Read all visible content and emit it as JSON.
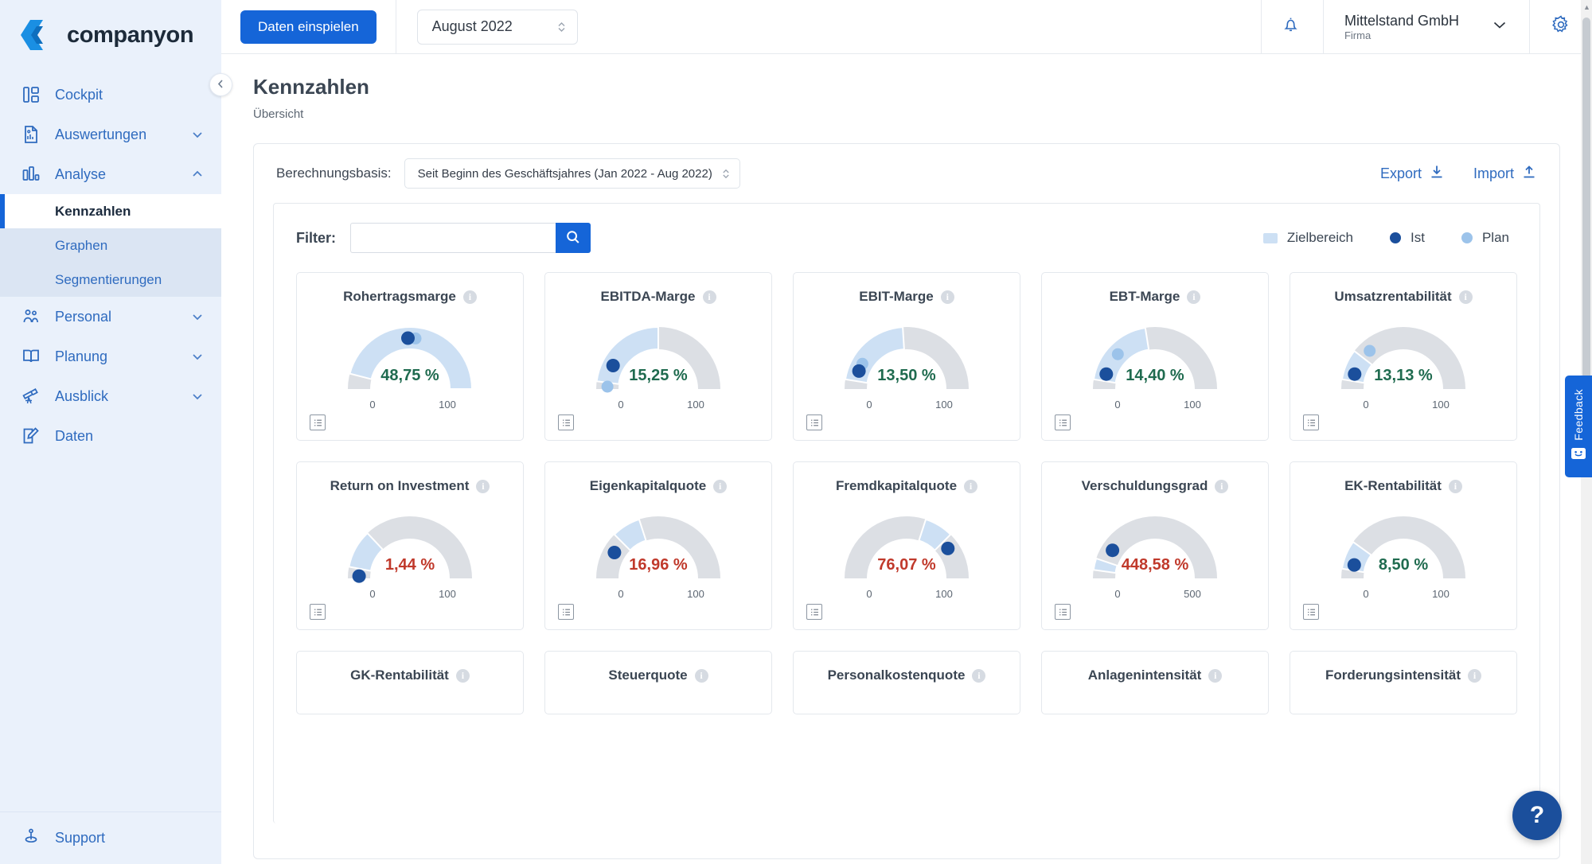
{
  "brand": {
    "name": "companyon",
    "logo_icon": "companyon-logo-icon"
  },
  "sidebar": {
    "items": [
      {
        "label": "Cockpit",
        "icon": "dashboard-icon",
        "chevron": ""
      },
      {
        "label": "Auswertungen",
        "icon": "report-icon",
        "chevron": "chevron-down-icon"
      },
      {
        "label": "Analyse",
        "icon": "bar-chart-icon",
        "chevron": "chevron-up-icon"
      }
    ],
    "submenu": [
      {
        "label": "Kennzahlen",
        "active": true
      },
      {
        "label": "Graphen",
        "active": false
      },
      {
        "label": "Segmentierungen",
        "active": false
      }
    ],
    "items_after": [
      {
        "label": "Personal",
        "icon": "people-icon",
        "chevron": "chevron-down-icon"
      },
      {
        "label": "Planung",
        "icon": "book-icon",
        "chevron": "chevron-down-icon"
      },
      {
        "label": "Ausblick",
        "icon": "telescope-icon",
        "chevron": "chevron-down-icon"
      },
      {
        "label": "Daten",
        "icon": "edit-square-icon",
        "chevron": ""
      }
    ],
    "support": {
      "label": "Support",
      "icon": "support-icon"
    },
    "collapse": {
      "icon": "chevron-left-icon"
    }
  },
  "topbar": {
    "import_button": "Daten einspielen",
    "period": "August 2022",
    "notifications_icon": "bell-icon",
    "company_name": "Mittelstand GmbH",
    "company_role": "Firma",
    "company_chevron_icon": "chevron-down-icon",
    "settings_icon": "gear-icon"
  },
  "page": {
    "title": "Kennzahlen",
    "subtitle": "Übersicht"
  },
  "toolbar": {
    "basis_label": "Berechnungsbasis:",
    "basis_value": "Seit Beginn des Geschäftsjahres (Jan 2022 - Aug 2022)",
    "export_label": "Export",
    "export_icon": "download-icon",
    "import_label": "Import",
    "import_icon": "upload-icon"
  },
  "filter": {
    "label": "Filter:",
    "value": "",
    "placeholder": "",
    "search_icon": "search-icon"
  },
  "legend": [
    {
      "label": "Zielbereich",
      "type": "rect",
      "color": "#cde0f4"
    },
    {
      "label": "Ist",
      "type": "dot",
      "color": "#1b4f9c"
    },
    {
      "label": "Plan",
      "type": "dot",
      "color": "#9cc3ea"
    }
  ],
  "colors": {
    "accent": "#1565d8",
    "link": "#2f6bbf",
    "target_band": "#cde0f4",
    "track": "#dcdfe4",
    "ist_dot": "#1b4f9c",
    "plan_dot": "#9cc3ea",
    "value_good": "#1f6b4f",
    "value_bad": "#c0392b"
  },
  "chart_data": {
    "type": "gauge-grid",
    "title": "Kennzahlen Übersicht",
    "legend": [
      "Zielbereich",
      "Ist",
      "Plan"
    ],
    "series_info": {
      "Zielbereich": "target band (light blue arc)",
      "Ist": "actual value (dark blue dot)",
      "Plan": "planned value (light blue dot)"
    },
    "gauges": [
      {
        "title": "Rohertragsmarge",
        "value_text": "48,75 %",
        "value": 48.75,
        "status": "good",
        "scale_min": 0,
        "scale_max": 100,
        "tick_labels": [
          "0",
          "100"
        ],
        "target_start": 8,
        "target_end": 100,
        "ist": 48.75,
        "plan": 53.5
      },
      {
        "title": "EBITDA-Marge",
        "value_text": "15,25 %",
        "value": 15.25,
        "status": "good",
        "scale_min": 0,
        "scale_max": 100,
        "tick_labels": [
          "0",
          "100"
        ],
        "target_start": 4,
        "target_end": 50,
        "ist": 15.25,
        "plan": 1.5
      },
      {
        "title": "EBIT-Marge",
        "value_text": "13,50 %",
        "value": 13.5,
        "status": "good",
        "scale_min": 0,
        "scale_max": 100,
        "tick_labels": [
          "0",
          "100"
        ],
        "target_start": 5,
        "target_end": 48,
        "ist": 11.5,
        "plan": 16.5
      },
      {
        "title": "EBT-Marge",
        "value_text": "14,40 %",
        "value": 14.4,
        "status": "good",
        "scale_min": 0,
        "scale_max": 100,
        "tick_labels": [
          "0",
          "100"
        ],
        "target_start": 5,
        "target_end": 45,
        "ist": 9.5,
        "plan": 24
      },
      {
        "title": "Umsatzrentabilität",
        "value_text": "13,13 %",
        "value": 13.13,
        "status": "good",
        "scale_min": 0,
        "scale_max": 100,
        "tick_labels": [
          "0",
          "100"
        ],
        "target_start": 5,
        "target_end": 21,
        "ist": 9.5,
        "plan": 27
      },
      {
        "title": "Return on Investment",
        "value_text": "1,44 %",
        "value": 1.44,
        "status": "bad",
        "scale_min": 0,
        "scale_max": 100,
        "tick_labels": [
          "0",
          "100"
        ],
        "target_start": 6,
        "target_end": 26,
        "ist": 1.44,
        "plan": null
      },
      {
        "title": "Eigenkapitalquote",
        "value_text": "16,96 %",
        "value": 16.96,
        "status": "bad",
        "scale_min": 0,
        "scale_max": 100,
        "tick_labels": [
          "0",
          "100"
        ],
        "target_start": 25,
        "target_end": 40,
        "ist": 16.96,
        "plan": null
      },
      {
        "title": "Fremdkapitalquote",
        "value_text": "76,07 %",
        "value": 76.07,
        "status": "bad",
        "scale_min": 0,
        "scale_max": 100,
        "tick_labels": [
          "0",
          "100"
        ],
        "target_start": 60,
        "target_end": 75,
        "ist": 80,
        "plan": null
      },
      {
        "title": "Verschuldungsgrad",
        "value_text": "448,58 %",
        "value": 448.58,
        "status": "bad",
        "scale_min": 0,
        "scale_max": 500,
        "tick_labels": [
          "0",
          "500"
        ],
        "target_start": 22,
        "target_end": 52,
        "ist": 93,
        "plan": null
      },
      {
        "title": "EK-Rentabilität",
        "value_text": "8,50 %",
        "value": 8.5,
        "status": "good",
        "scale_min": 0,
        "scale_max": 100,
        "tick_labels": [
          "0",
          "100"
        ],
        "target_start": 5,
        "target_end": 20,
        "ist": 8.5,
        "plan": null
      },
      {
        "title": "GK-Rentabilität",
        "value_text": "",
        "value": null,
        "status": "",
        "partial": true
      },
      {
        "title": "Steuerquote",
        "value_text": "",
        "value": null,
        "status": "",
        "partial": true
      },
      {
        "title": "Personalkostenquote",
        "value_text": "",
        "value": null,
        "status": "",
        "partial": true
      },
      {
        "title": "Anlagenintensität",
        "value_text": "",
        "value": null,
        "status": "",
        "partial": true
      },
      {
        "title": "Forderungsintensität",
        "value_text": "",
        "value": null,
        "status": "",
        "partial": true
      }
    ]
  },
  "feedback": {
    "label": "Feedback",
    "icon": "smiley-icon"
  },
  "help": {
    "label": "?",
    "icon": "question-mark-icon"
  }
}
